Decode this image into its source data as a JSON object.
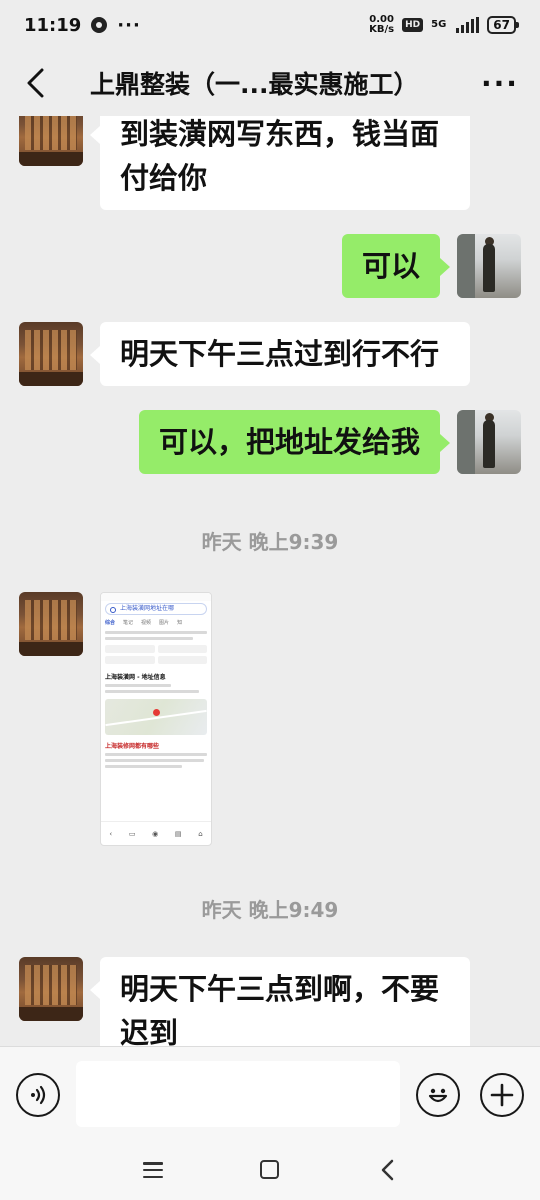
{
  "status_bar": {
    "time": "11:19",
    "more": "···",
    "net_speed_value": "0.00",
    "net_speed_unit": "KB/s",
    "hd": "HD",
    "network": "5G",
    "battery": "67"
  },
  "header": {
    "title": "上鼎整装（一...最实惠施工）",
    "more": "···"
  },
  "messages": [
    {
      "side": "in",
      "text": "到装潢网写东西，钱当面付给你"
    },
    {
      "side": "out",
      "text": "可以"
    },
    {
      "side": "in",
      "text": "明天下午三点过到行不行"
    },
    {
      "side": "out",
      "text": "可以，把地址发给我"
    }
  ],
  "timestamps": [
    "昨天 晚上9:39",
    "昨天 晚上9:49"
  ],
  "screenshot_preview": {
    "search_text": "上海装潢网地址在哪",
    "tabs": [
      "综合",
      "笔记",
      "视频",
      "图片",
      "知"
    ],
    "result_title": "上海装潢网 - 地址信息",
    "red_title": "上海装修网都有哪些"
  },
  "last_message": "明天下午三点到啊，不要迟到",
  "input": {
    "placeholder": ""
  },
  "colors": {
    "outgoing_bubble": "#95ec69",
    "incoming_bubble": "#ffffff",
    "background": "#ededed"
  }
}
